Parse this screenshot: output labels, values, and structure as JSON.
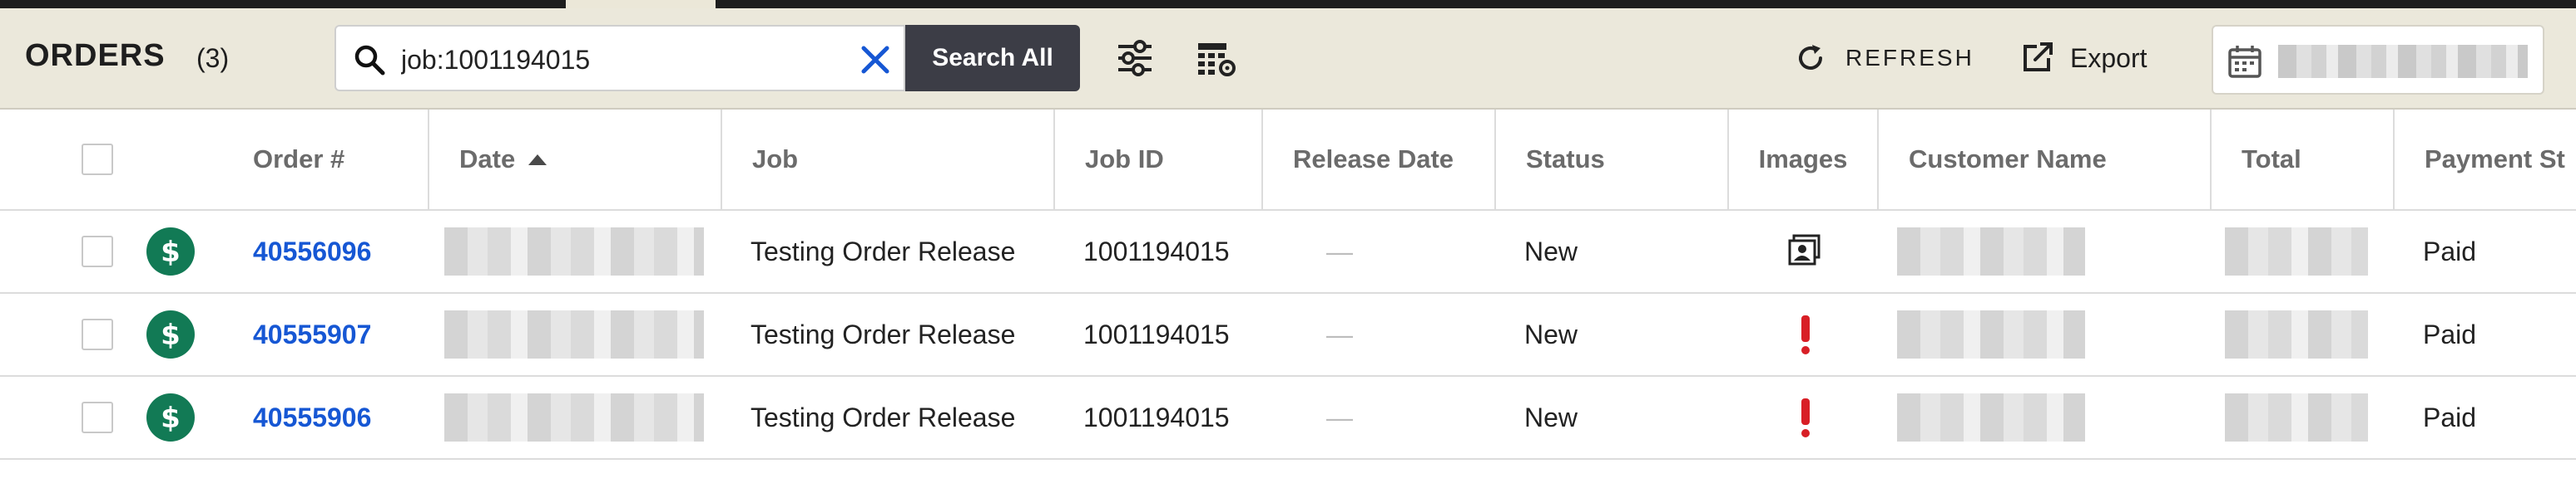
{
  "header": {
    "title": "ORDERS",
    "count": "(3)",
    "search": {
      "value": "job:1001194015",
      "placeholder": ""
    },
    "search_all_label": "Search All",
    "refresh_label": "REFRESH",
    "export_label": "Export"
  },
  "icons": {
    "search": "search-icon",
    "clear": "close-icon",
    "filter": "sliders-icon",
    "table_settings": "table-settings-icon",
    "refresh": "refresh-icon",
    "export": "export-icon",
    "calendar": "calendar-icon",
    "paid": "dollar-icon",
    "warning": "exclamation-icon",
    "photo": "photo-icon"
  },
  "colors": {
    "toolbar_bg": "#ebe8db",
    "search_all_bg": "#3c3d46",
    "link": "#1657d4",
    "paid_badge": "#127a55",
    "warning": "#d81f26",
    "clear_icon": "#1657d4"
  },
  "table": {
    "columns": [
      "Order #",
      "Date",
      "Job",
      "Job ID",
      "Release Date",
      "Status",
      "Images",
      "Customer Name",
      "Total",
      "Payment St"
    ],
    "sorted_column": "Date",
    "rows": [
      {
        "order": "40556096",
        "job": "Testing Order Release",
        "job_id": "1001194015",
        "release_date": "—",
        "status": "New",
        "image": "photo",
        "payment": "Paid"
      },
      {
        "order": "40555907",
        "job": "Testing Order Release",
        "job_id": "1001194015",
        "release_date": "—",
        "status": "New",
        "image": "warning",
        "payment": "Paid"
      },
      {
        "order": "40555906",
        "job": "Testing Order Release",
        "job_id": "1001194015",
        "release_date": "—",
        "status": "New",
        "image": "warning",
        "payment": "Paid"
      }
    ]
  }
}
